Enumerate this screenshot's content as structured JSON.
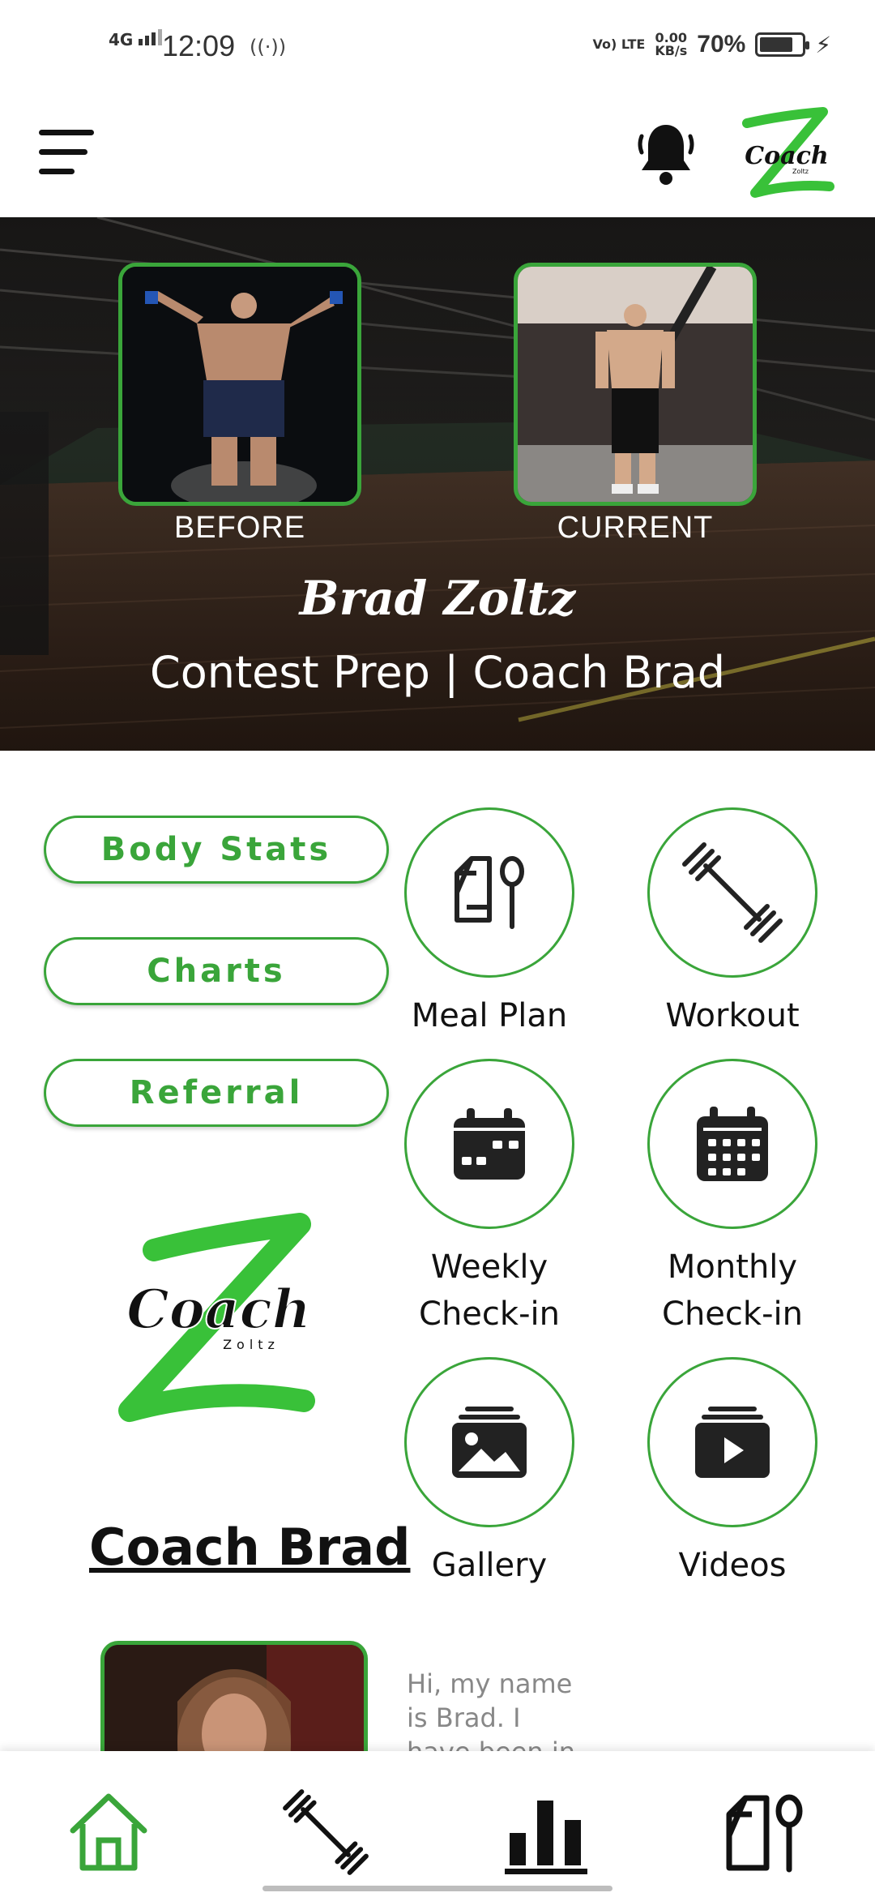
{
  "status_bar": {
    "network": "4G",
    "time": "12:09",
    "volte": "Vo) LTE",
    "speed_value": "0.00",
    "speed_unit": "KB/s",
    "battery": "70%"
  },
  "header": {
    "logo_icon": "coach-zoltz-logo",
    "menu_icon": "menu-icon",
    "notification_icon": "bell-icon"
  },
  "hero": {
    "before_label": "BEFORE",
    "current_label": "CURRENT",
    "name": "Brad Zoltz",
    "subtitle": "Contest Prep | Coach Brad"
  },
  "quick_links": [
    {
      "label": "Body Stats"
    },
    {
      "label": "Charts"
    },
    {
      "label": "Referral"
    }
  ],
  "tiles": [
    {
      "label": "Meal Plan",
      "icon": "meal-plan-icon"
    },
    {
      "label": "Workout",
      "icon": "barbell-icon"
    },
    {
      "label": "Weekly\nCheck-in",
      "icon": "calendar-week-icon"
    },
    {
      "label": "Monthly\nCheck-in",
      "icon": "calendar-month-icon"
    },
    {
      "label": "Gallery",
      "icon": "image-icon"
    },
    {
      "label": "Videos",
      "icon": "video-icon"
    }
  ],
  "coach": {
    "heading": "Coach Brad",
    "bio": "Hi, my name is Brad. I have been in"
  },
  "bottom_nav": [
    {
      "name": "home",
      "icon": "home-icon",
      "active": true
    },
    {
      "name": "workout",
      "icon": "barbell-icon",
      "active": false
    },
    {
      "name": "stats",
      "icon": "bar-chart-icon",
      "active": false
    },
    {
      "name": "meal",
      "icon": "meal-plan-icon",
      "active": false
    }
  ],
  "colors": {
    "accent": "#3aa53a",
    "text": "#111111",
    "muted": "#888888",
    "background": "#ffffff"
  }
}
